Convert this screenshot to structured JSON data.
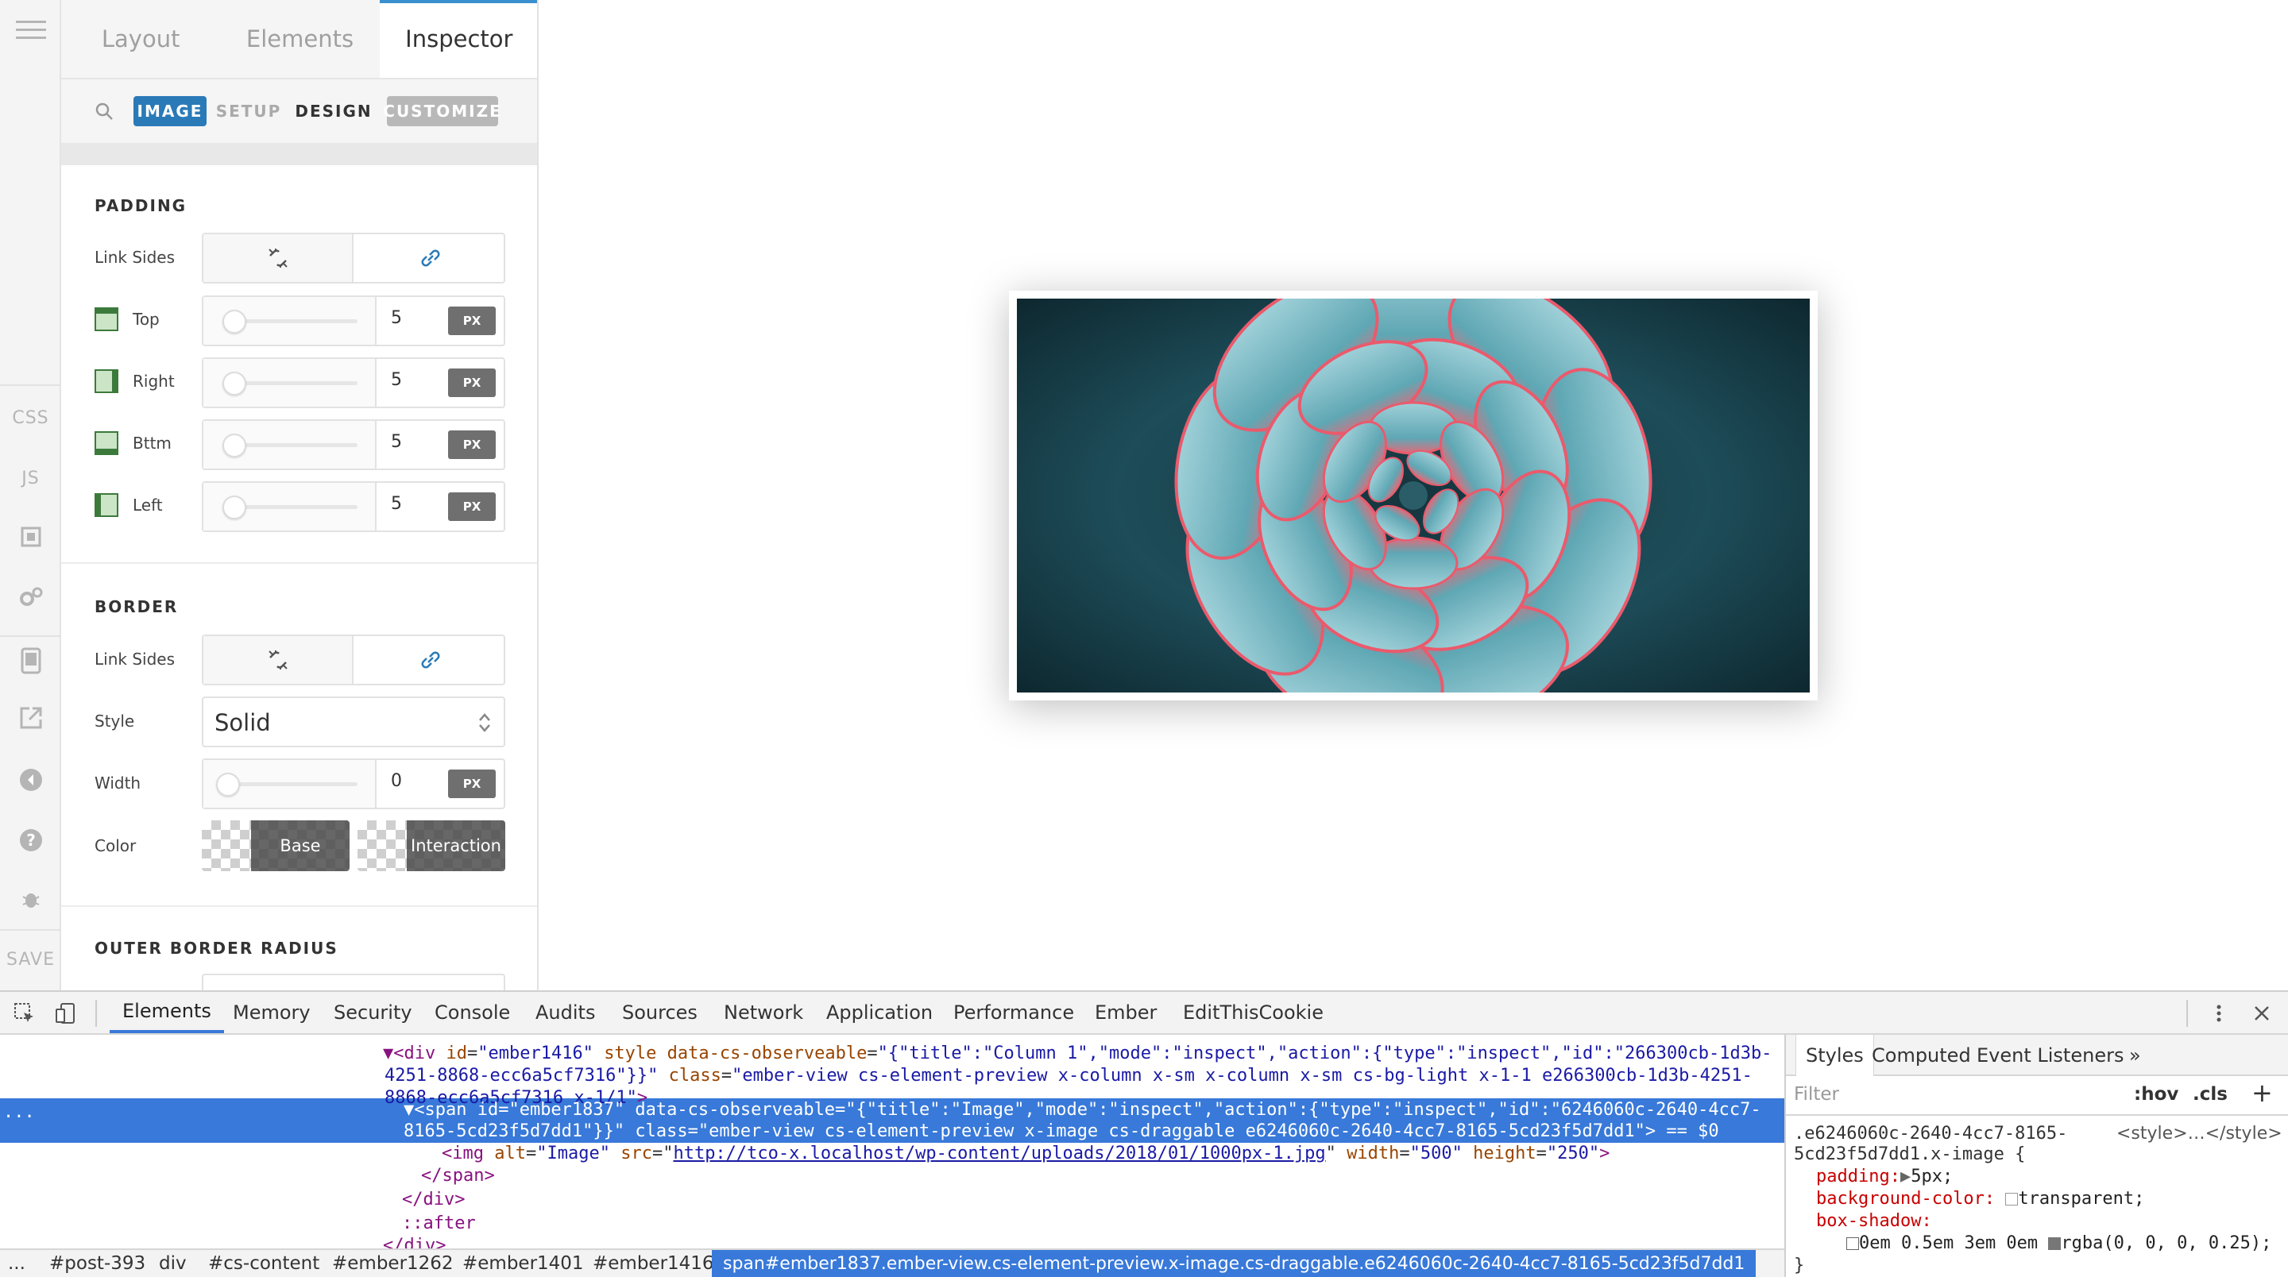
{
  "rail": {
    "css_label": "CSS",
    "js_label": "JS",
    "save_label": "SAVE"
  },
  "panel": {
    "tabs": [
      {
        "label": "Layout"
      },
      {
        "label": "Elements"
      },
      {
        "label": "Inspector"
      }
    ],
    "subnav": {
      "element_badge": "IMAGE",
      "setup": "SETUP",
      "design": "DESIGN",
      "customize": "CUSTOMIZE"
    },
    "padding": {
      "title": "PADDING",
      "link_sides_label": "Link Sides",
      "rows": [
        {
          "label": "Top",
          "value": "5",
          "unit": "PX"
        },
        {
          "label": "Right",
          "value": "5",
          "unit": "PX"
        },
        {
          "label": "Bttm",
          "value": "5",
          "unit": "PX"
        },
        {
          "label": "Left",
          "value": "5",
          "unit": "PX"
        }
      ]
    },
    "border": {
      "title": "BORDER",
      "link_sides_label": "Link Sides",
      "style_label": "Style",
      "style_value": "Solid",
      "width_label": "Width",
      "width_value": "0",
      "width_unit": "PX",
      "color_label": "Color",
      "color_base": "Base",
      "color_interaction": "Interaction"
    },
    "outer_radius": {
      "title": "OUTER BORDER RADIUS"
    }
  },
  "devtools": {
    "tabs": [
      "Elements",
      "Memory",
      "Security",
      "Console",
      "Audits",
      "Sources",
      "Network",
      "Application",
      "Performance",
      "Ember",
      "EditThisCookie"
    ],
    "dom": {
      "line1_a": "<div ",
      "line1_id_attr": "id",
      "line1_id_val": "\"ember1416\"",
      "line1_style": "style",
      "line1_obs_attr": "data-cs-observeable",
      "line1_obs_val": "\"{\"title\":\"Column 1\",\"mode\":\"inspect\",\"action\":{\"type\":\"inspect\",\"id\":\"266300cb-1d3b-",
      "line2": "4251-8868-ecc6a5cf7316\"}}\"",
      "line2_class_attr": "class",
      "line2_class_val": "\"ember-view cs-element-preview x-column x-sm x-column x-sm cs-bg-light x-1-1 e266300cb-1d3b-4251-",
      "line3": "8868-ecc6a5cf7316 x-1/1\"",
      "sel_line1": "<span id=\"ember1837\" data-cs-observeable=\"{\"title\":\"Image\",\"mode\":\"inspect\",\"action\":{\"type\":\"inspect\",\"id\":\"6246060c-2640-4cc7-",
      "sel_line2": "8165-5cd23f5d7dd1\"}}\" class=\"ember-view cs-element-preview x-image cs-draggable e6246060c-2640-4cc7-8165-5cd23f5d7dd1\"> == $0",
      "img_alt_attr": "alt",
      "img_alt_val": "\"Image\"",
      "img_src_attr": "src",
      "img_src_val": "http://tco-x.localhost/wp-content/uploads/2018/01/1000px-1.jpg",
      "img_width_attr": "width",
      "img_width_val": "\"500\"",
      "img_height_attr": "height",
      "img_height_val": "\"250\"",
      "close_span": "</span>",
      "close_div": "</div>",
      "after": "::after",
      "close_div2": "</div>"
    },
    "breadcrumbs": [
      "...",
      "#post-393",
      "div",
      "#cs-content",
      "#ember1262",
      "#ember1401",
      "#ember1416",
      "span#ember1837.ember-view.cs-element-preview.x-image.cs-draggable.e6246060c-2640-4cc7-8165-5cd23f5d7dd1"
    ],
    "styles": {
      "tabs": [
        "Styles",
        "Computed",
        "Event Listeners"
      ],
      "more": "»",
      "filter_placeholder": "Filter",
      "hov": ":hov",
      "cls": ".cls",
      "plus": "+",
      "selector_line1": ".e6246060c-2640-4cc7-8165-",
      "selector_line2": "5cd23f5d7dd1.x-image {",
      "source": "<style>…</style>",
      "padding_prop": "padding:",
      "padding_val": "5px;",
      "bg_prop": "background-color:",
      "bg_val": "transparent;",
      "shadow_prop": "box-shadow:",
      "shadow_val_a": "0em 0.5em 3em 0em",
      "shadow_val_b": "rgba(0, 0, 0, 0.25);",
      "close_brace": "}"
    }
  },
  "colors": {
    "accent": "#3a8fcf",
    "badge": "#2a7ab8",
    "customize_bg": "#b8b8b8",
    "devtools_select": "#3879d9"
  }
}
